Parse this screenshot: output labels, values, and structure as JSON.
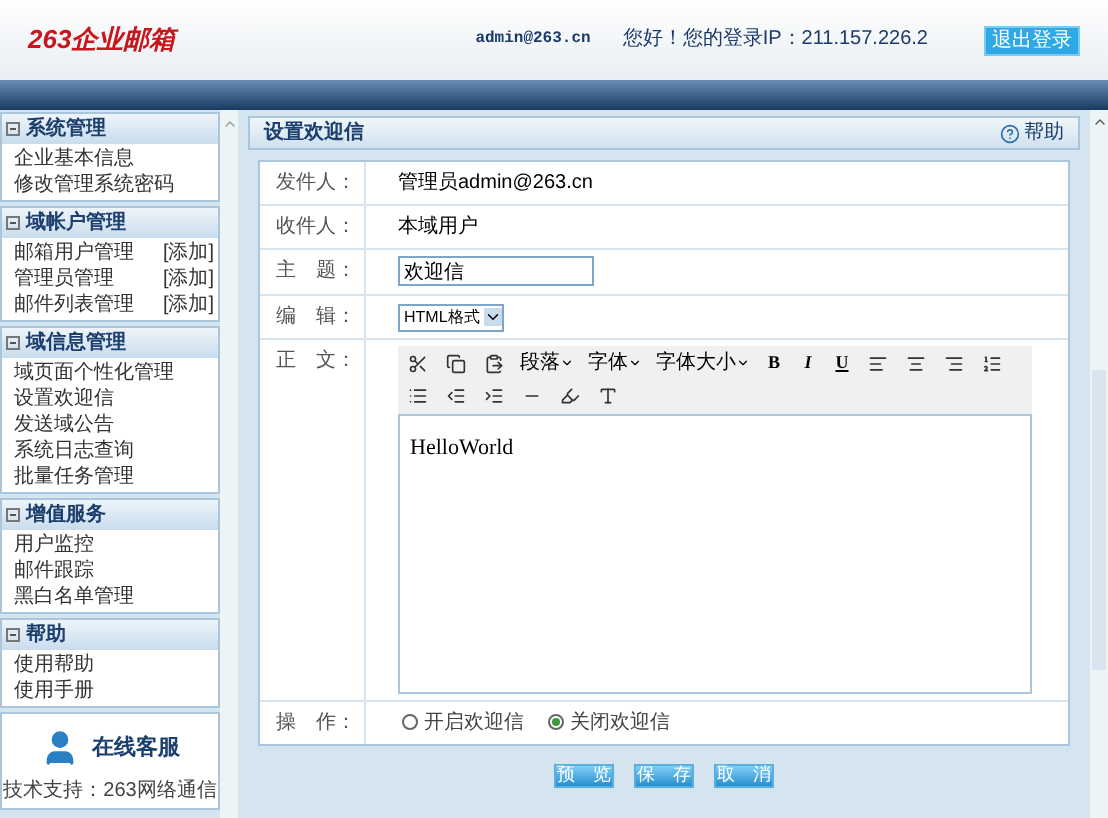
{
  "header": {
    "logo": "263企业邮箱",
    "account": "admin@263.cn",
    "login_info": "您好！您的登录IP：211.157.226.2",
    "logout_button": "退出登录"
  },
  "sidebar": {
    "sections": [
      {
        "title": "系统管理",
        "expanded": true,
        "items": [
          {
            "label": "企业基本信息"
          },
          {
            "label": "修改管理系统密码"
          }
        ]
      },
      {
        "title": "域帐户管理",
        "expanded": true,
        "items": [
          {
            "label": "邮箱用户管理",
            "action": "[添加]"
          },
          {
            "label": "管理员管理",
            "action": "[添加]"
          },
          {
            "label": "邮件列表管理",
            "action": "[添加]"
          }
        ]
      },
      {
        "title": "域信息管理",
        "expanded": true,
        "items": [
          {
            "label": "域页面个性化管理"
          },
          {
            "label": "设置欢迎信"
          },
          {
            "label": "发送域公告"
          },
          {
            "label": "系统日志查询"
          },
          {
            "label": "批量任务管理"
          }
        ]
      },
      {
        "title": "增值服务",
        "expanded": true,
        "items": [
          {
            "label": "用户监控"
          },
          {
            "label": "邮件跟踪"
          },
          {
            "label": "黑白名单管理"
          }
        ]
      },
      {
        "title": "帮助",
        "expanded": true,
        "items": [
          {
            "label": "使用帮助"
          },
          {
            "label": "使用手册"
          }
        ]
      }
    ],
    "support": {
      "title": "在线客服",
      "footer": "技术支持：263网络通信"
    }
  },
  "panel": {
    "title": "设置欢迎信",
    "help": "帮助"
  },
  "form": {
    "sender_label": "发件人：",
    "sender": "管理员admin@263.cn",
    "recipient_label": "收件人：",
    "recipient": "本域用户",
    "subject_label": "主　题：",
    "subject": "欢迎信",
    "editor_label": "编　辑：",
    "editor_mode": "HTML格式",
    "body_label": "正　文：",
    "body": "HelloWorld",
    "action_label": "操　作：",
    "toolbar_menus": [
      "段落",
      "字体",
      "字体大小"
    ],
    "format_buttons": [
      "B",
      "I",
      "U"
    ],
    "options": [
      {
        "label": "开启欢迎信",
        "selected": false
      },
      {
        "label": "关闭欢迎信",
        "selected": true
      }
    ]
  },
  "buttons": [
    "预　览",
    "保　存",
    "取　消"
  ]
}
